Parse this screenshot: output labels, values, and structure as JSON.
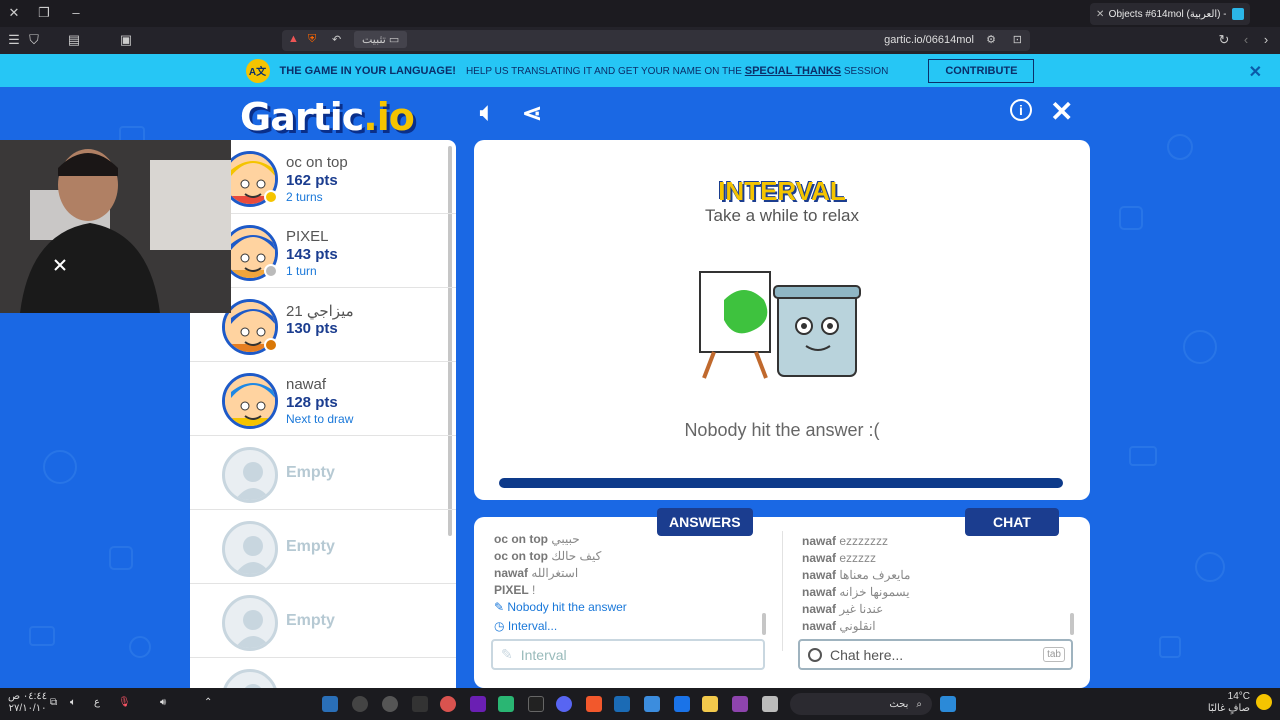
{
  "browser": {
    "tab_title": "Objects #614mol (العربية) - Gartic",
    "url": "gartic.io/06614mol",
    "install_label": "تثبيت"
  },
  "banner": {
    "headline": "THE GAME IN YOUR LANGUAGE!",
    "text_before": "HELP US TRANSLATING IT AND GET YOUR NAME ON THE",
    "link": "SPECIAL THANKS",
    "text_after": "SESSION",
    "button": "CONTRIBUTE"
  },
  "logo": {
    "main": "Gartic",
    "suffix": ".io"
  },
  "players": [
    {
      "name": "oc on top",
      "pts": "162 pts",
      "info": "2 turns",
      "hair": "#f4c400",
      "shirt": "#e94b3c",
      "dot": "#f5c400"
    },
    {
      "name": "PIXEL",
      "pts": "143 pts",
      "info": "1 turn",
      "hair": "#1e5ac8",
      "shirt": "#f0a53c",
      "dot": "#bbbbbb"
    },
    {
      "name": "ميزاجي 21",
      "pts": "130 pts",
      "info": "",
      "hair": "#1e5ac8",
      "shirt": "#e67e22",
      "dot": "#d97706"
    },
    {
      "name": "nawaf",
      "pts": "128 pts",
      "info": "Next to draw",
      "hair": "#1e88e5",
      "shirt": "#f5c400",
      "dot": ""
    }
  ],
  "empty_label": "Empty",
  "round": {
    "title": "INTERVAL",
    "subtitle": "Take a while to relax",
    "result": "Nobody hit the answer :(",
    "progress": 1.0
  },
  "answers": {
    "tab": "ANSWERS",
    "messages": [
      {
        "user": "oc on top",
        "text": "حبيبي"
      },
      {
        "user": "oc on top",
        "text": "كيف حالك"
      },
      {
        "user": "nawaf",
        "text": "استغرالله"
      },
      {
        "user": "PIXEL",
        "text": "!"
      }
    ],
    "system": [
      "Nobody hit the answer",
      "Interval..."
    ],
    "placeholder": "Interval"
  },
  "chat": {
    "tab": "CHAT",
    "messages": [
      {
        "user": "nawaf",
        "text": "ezzzzzzz"
      },
      {
        "user": "nawaf",
        "text": "ezzzzz"
      },
      {
        "user": "nawaf",
        "text": "مايعرف معناها"
      },
      {
        "user": "nawaf",
        "text": "يسمونها خزانه"
      },
      {
        "user": "nawaf",
        "text": "عندنا غير"
      },
      {
        "user": "nawaf",
        "text": "انقلوني"
      }
    ],
    "placeholder": "Chat here...",
    "tab_hint": "tab"
  },
  "taskbar": {
    "time": "٠٤:٤٤ ص",
    "date": "٢٧/١٠/١٠",
    "search": "بحث",
    "weather_temp": "14°C",
    "weather_desc": "صافٍ غالبًا"
  }
}
